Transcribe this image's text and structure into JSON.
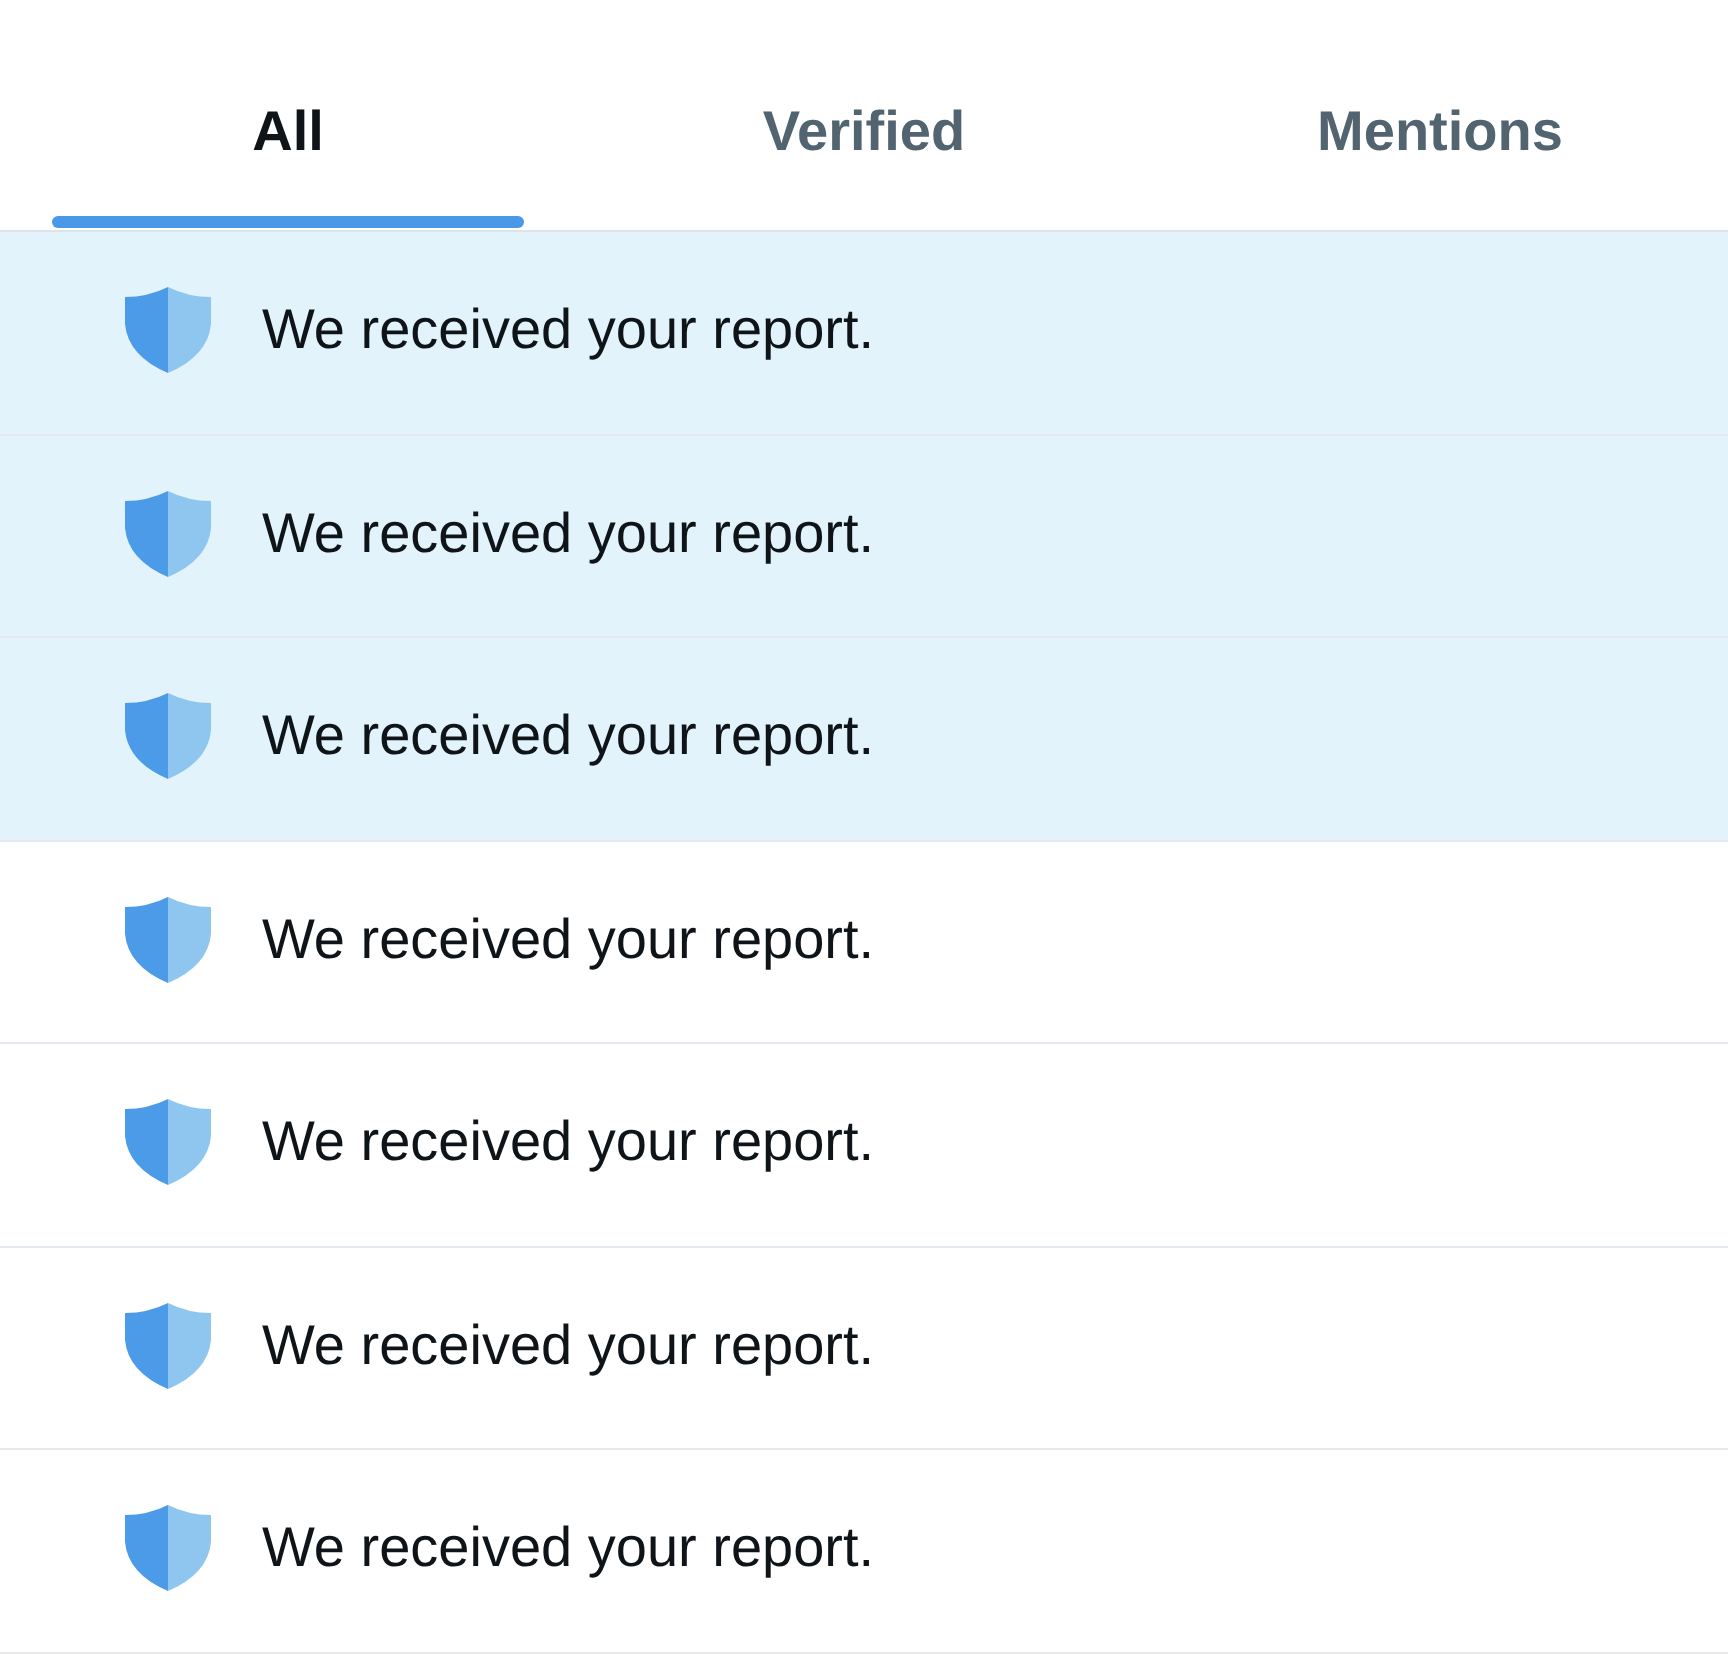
{
  "tabs": [
    {
      "label": "All",
      "selected": true
    },
    {
      "label": "Verified",
      "selected": false
    },
    {
      "label": "Mentions",
      "selected": false
    }
  ],
  "notifications": [
    {
      "text": "We received your report.",
      "unread": true
    },
    {
      "text": "We received your report.",
      "unread": true
    },
    {
      "text": "We received your report.",
      "unread": true
    },
    {
      "text": "We received your report.",
      "unread": false
    },
    {
      "text": "We received your report.",
      "unread": false
    },
    {
      "text": "We received your report.",
      "unread": false
    },
    {
      "text": "We received your report.",
      "unread": false
    }
  ]
}
